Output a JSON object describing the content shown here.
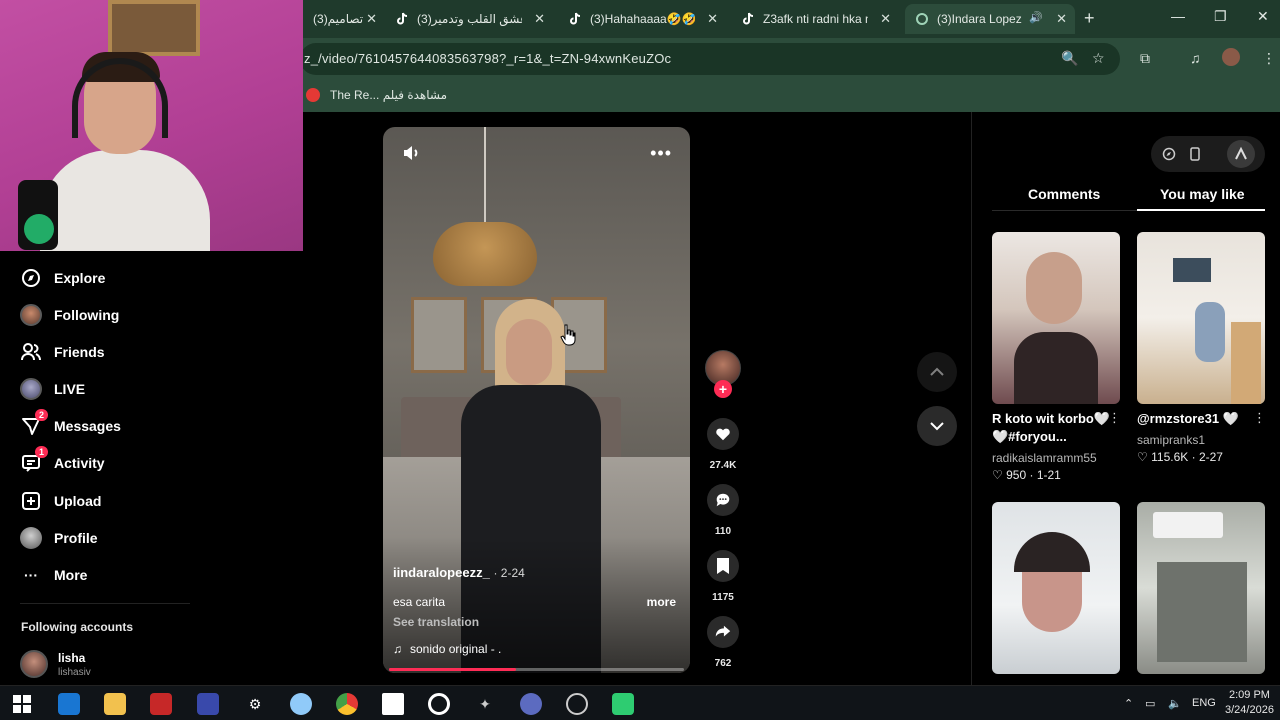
{
  "browser": {
    "tabs": [
      {
        "title": "تصاميم(3)",
        "active": false
      },
      {
        "title": "عشق القلب وتدمير(3)",
        "active": false
      },
      {
        "title": "(3)Hahahaaaa🤣🤣🤣",
        "active": false
      },
      {
        "title": "Z3afk nti radni hka nc",
        "active": false
      },
      {
        "title": "(3)Indara Lopez",
        "active": true
      }
    ],
    "url": "z_/video/7610457644083563798?_r=1&_t=ZN-94xwnKeuZOc",
    "bookmarks": [
      {
        "title": "The Re... مشاهدة فيلم"
      }
    ]
  },
  "sidebar": {
    "items": [
      {
        "label": "Explore",
        "icon": "compass-icon"
      },
      {
        "label": "Following",
        "icon": "avatar-icon"
      },
      {
        "label": "Friends",
        "icon": "friends-icon"
      },
      {
        "label": "LIVE",
        "icon": "live-icon"
      },
      {
        "label": "Messages",
        "icon": "messages-icon",
        "badge": "2"
      },
      {
        "label": "Activity",
        "icon": "activity-icon",
        "badge": "1"
      },
      {
        "label": "Upload",
        "icon": "upload-icon"
      },
      {
        "label": "Profile",
        "icon": "profile-icon"
      },
      {
        "label": "More",
        "icon": "more-icon"
      }
    ],
    "following_title": "Following accounts",
    "accounts": [
      {
        "name": "lisha",
        "handle": "lishasiv"
      }
    ]
  },
  "video": {
    "author": "iindaralopeezz_",
    "date": "· 2-24",
    "caption": "esa carita",
    "more": "more",
    "see_translation": "See translation",
    "sound": "sonido original - .",
    "progress": 0.43
  },
  "actions": {
    "likes": "27.4K",
    "comments": "110",
    "saves": "1175",
    "shares": "762"
  },
  "right_panel": {
    "tabs": [
      {
        "label": "Comments"
      },
      {
        "label": "You may like"
      }
    ],
    "active_tab": "You may like",
    "cards": [
      {
        "title": "R koto wit korbo🤍 🤍#foryou...",
        "user": "radikaislamramm55",
        "likes": "950",
        "date": "1-21"
      },
      {
        "title": "@rmzstore31 🤍",
        "user": "samipranks1",
        "likes": "115.6K",
        "date": "2-27"
      },
      {
        "title": "",
        "user": "",
        "likes": "",
        "date": ""
      },
      {
        "title": "",
        "user": "",
        "likes": "",
        "date": ""
      }
    ]
  },
  "taskbar": {
    "lang": "ENG",
    "time": "2:09 PM",
    "date": "3/24/2026"
  }
}
